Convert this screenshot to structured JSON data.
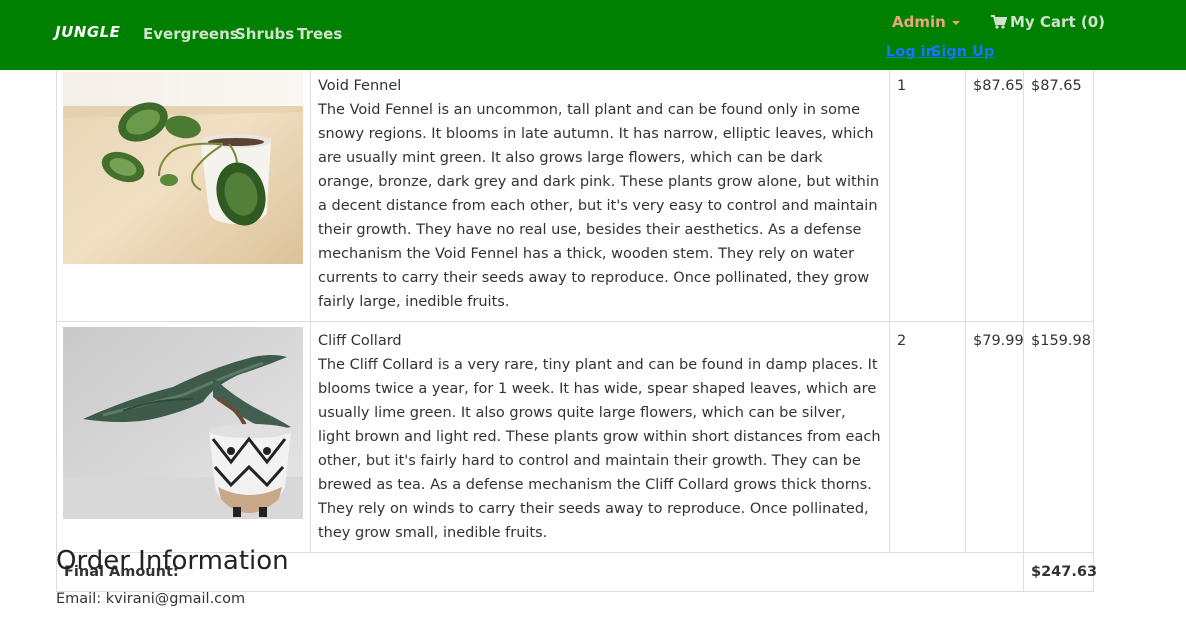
{
  "nav": {
    "brand": "JUNGLE",
    "links": [
      "Evergreens",
      "Shrubs",
      "Trees"
    ],
    "admin_label": "Admin",
    "cart_label": "My Cart (0)",
    "login_label": "Log in",
    "signup_label": "Sign Up"
  },
  "cart": {
    "items": [
      {
        "name": "Void Fennel",
        "description": "The Void Fennel is an uncommon, tall plant and can be found only in some snowy regions. It blooms in late autumn. It has narrow, elliptic leaves, which are usually mint green. It also grows large flowers, which can be dark orange, bronze, dark grey and dark pink. These plants grow alone, but within a decent distance from each other, but it's very easy to control and maintain their growth. They have no real use, besides their aesthetics. As a defense mechanism the Void Fennel has a thick, wooden stem. They rely on water currents to carry their seeds away to reproduce. Once pollinated, they grow fairly large, inedible fruits.",
        "quantity": "1",
        "price": "$87.65",
        "total": "$87.65",
        "image": "potted-pothos-plant-photo"
      },
      {
        "name": "Cliff Collard",
        "description": "The Cliff Collard is a very rare, tiny plant and can be found in damp places. It blooms twice a year, for 1 week. It has wide, spear shaped leaves, which are usually lime green. It also grows quite large flowers, which can be silver, light brown and light red. These plants grow within short distances from each other, but it's fairly hard to control and maintain their growth. They can be brewed as tea. As a defense mechanism the Cliff Collard grows thick thorns. They rely on winds to carry their seeds away to reproduce. Once pollinated, they grow small, inedible fruits.",
        "quantity": "2",
        "price": "$79.99",
        "total": "$159.98",
        "image": "bonsai-juniper-plant-photo"
      }
    ],
    "final_label": "Final Amount:",
    "final_amount": "$247.63"
  },
  "order": {
    "title": "Order Information",
    "email_line": "Email: kvirani@gmail.com"
  },
  "colors": {
    "navbar": "#008000",
    "admin": "#e8a87c",
    "auth_links": "#1a73ff"
  }
}
